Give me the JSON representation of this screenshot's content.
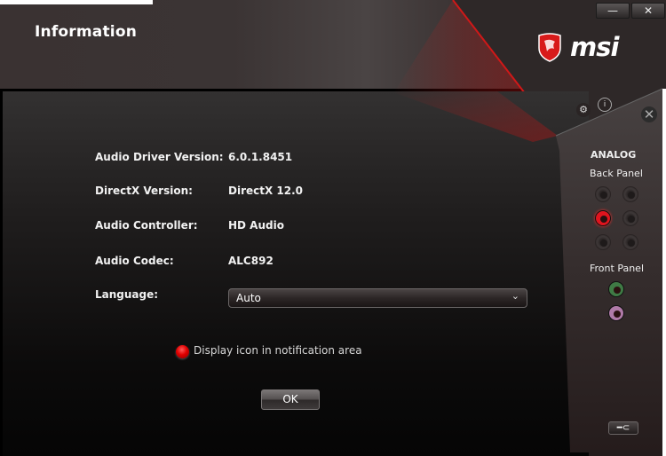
{
  "window": {
    "title": "Information",
    "minimize_label": "—",
    "close_label": "✕",
    "brand": "msi"
  },
  "header_icons": {
    "settings": "gear-icon",
    "info": "info-icon",
    "panel_close": "close-icon"
  },
  "info_rows": [
    {
      "label": "Audio Driver Version:",
      "value": "6.0.1.8451"
    },
    {
      "label": "DirectX Version:",
      "value": "DirectX 12.0"
    },
    {
      "label": "Audio Controller:",
      "value": "HD Audio"
    },
    {
      "label": "Audio Codec:",
      "value": "ALC892"
    }
  ],
  "language": {
    "label": "Language:",
    "selected": "Auto",
    "chevron": "⌄"
  },
  "notification": {
    "label": "Display icon in notification area",
    "checked": true
  },
  "ok_button": "OK",
  "side_panel": {
    "heading": "ANALOG",
    "back_panel_label": "Back Panel",
    "front_panel_label": "Front Panel",
    "back_jacks": [
      {
        "color": "#3a3535",
        "active": false
      },
      {
        "color": "#3a3535",
        "active": false
      },
      {
        "color": "#e0141e",
        "active": true
      },
      {
        "color": "#3a3535",
        "active": false
      },
      {
        "color": "#3a3535",
        "active": false
      },
      {
        "color": "#3a3535",
        "active": false
      }
    ],
    "front_jacks": [
      {
        "color": "#3f7a45",
        "active": true
      },
      {
        "color": "#b07aa8",
        "active": true
      }
    ],
    "tool_button_icon": "wrench-icon"
  },
  "colors": {
    "accent_red": "#e0141e",
    "text": "#f2f2f2"
  }
}
